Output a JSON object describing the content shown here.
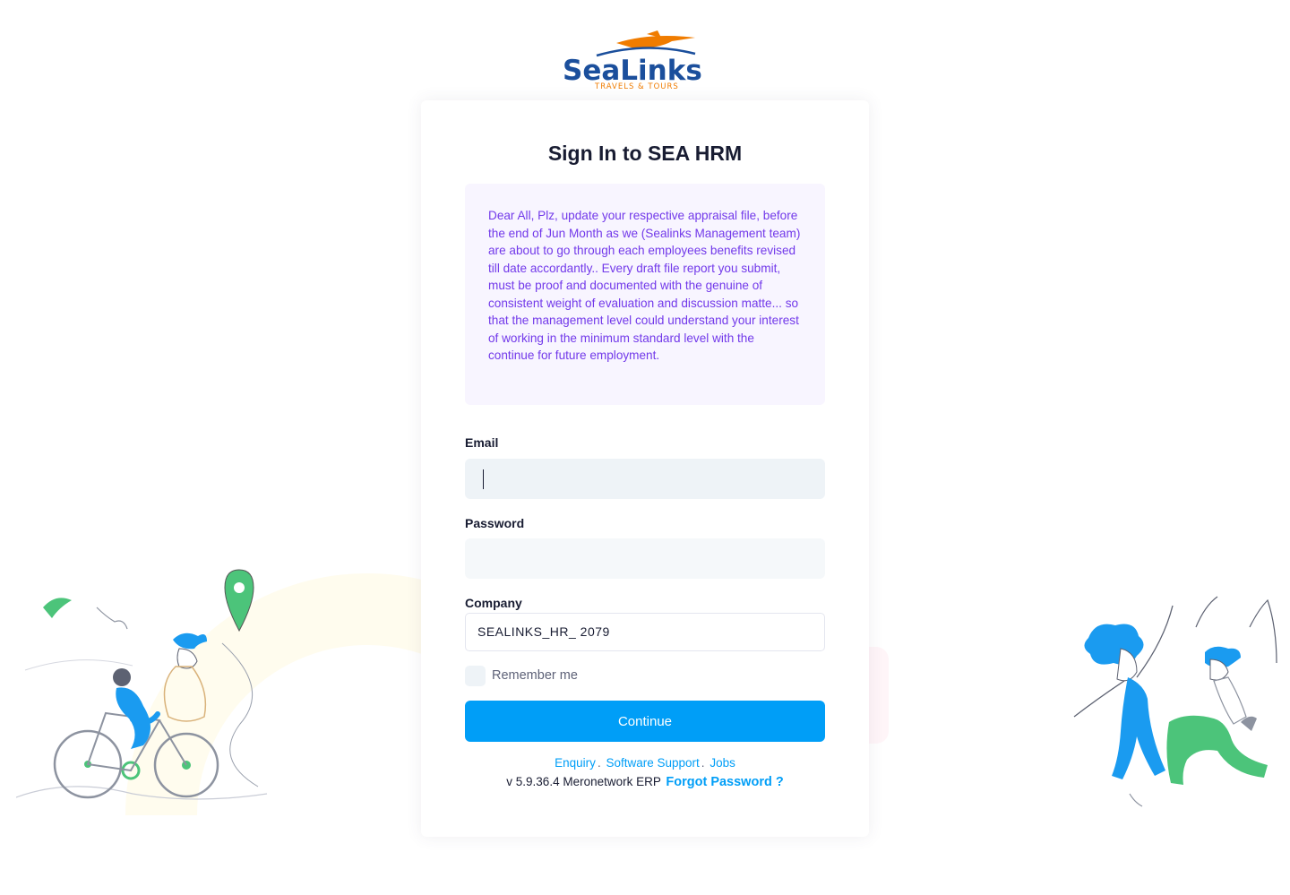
{
  "brand": {
    "name": "SeaLinks",
    "tagline": "TRAVELS & TOURS",
    "colors": {
      "blue": "#1b4f9c",
      "orange": "#f07c00"
    }
  },
  "card": {
    "title": "Sign In to SEA HRM",
    "notice": "Dear All, Plz, update your respective appraisal file, before the end of Jun Month as we (Sealinks Management team) are about to go through each employees benefits revised till date accordantly.. Every draft file report you submit, must be proof and documented with the genuine of consistent weight of evaluation and discussion matte... so that the management level could understand your interest of working in the minimum standard level with the continue for future employment."
  },
  "form": {
    "email_label": "Email",
    "email_value": "",
    "password_label": "Password",
    "password_value": "",
    "company_label": "Company",
    "company_value": "SEALINKS_HR_ 2079",
    "remember_label": "Remember me",
    "remember_checked": false,
    "submit_label": "Continue"
  },
  "footer": {
    "links": [
      "Enquiry",
      "Software Support",
      "Jobs"
    ],
    "separator": ".",
    "version": "v 5.9.36.4 Meronetwork ERP",
    "forgot_label": "Forgot Password ?"
  },
  "colors": {
    "primary": "#009ef7",
    "notice_bg": "#f8f5ff",
    "notice_text": "#7239ea",
    "input_bg": "#f5f8fa",
    "illustration_blue": "#1a9bf0",
    "illustration_green": "#4cc47a"
  }
}
